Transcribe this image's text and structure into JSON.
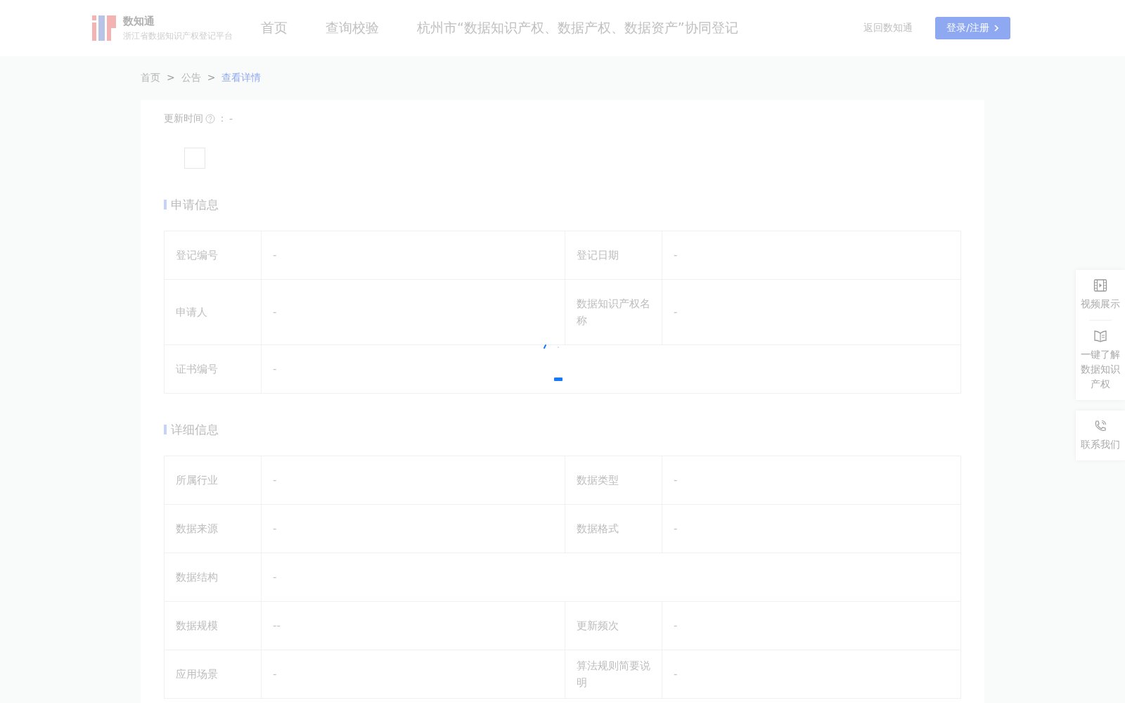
{
  "header": {
    "brand": "数知通",
    "subtitle": "浙江省数据知识产权登记平台",
    "nav": [
      {
        "label": "首页",
        "selected": false
      },
      {
        "label": "查询校验",
        "selected": false
      },
      {
        "label": "杭州市“数据知识产权、数据产权、数据资产”协同登记",
        "selected": false
      }
    ],
    "back_link": "返回数知通",
    "login_button": "登录/注册"
  },
  "breadcrumb": [
    {
      "label": "首页",
      "selected": false
    },
    {
      "label": "公告",
      "selected": false
    },
    {
      "label": "查看详情",
      "selected": true
    }
  ],
  "breadcrumb_separator": ">",
  "update_time": {
    "label": "更新时间",
    "colon": "：",
    "value": "-"
  },
  "sections": [
    {
      "title": "申请信息",
      "rows": [
        [
          {
            "label": "登记编号",
            "value": "-"
          },
          {
            "label": "登记日期",
            "value": "-"
          }
        ],
        [
          {
            "label": "申请人",
            "value": "-"
          },
          {
            "label": "数据知识产权名称",
            "value": "-"
          }
        ],
        [
          {
            "label": "证书编号",
            "value": "-"
          }
        ]
      ]
    },
    {
      "title": "详细信息",
      "rows": [
        [
          {
            "label": "所属行业",
            "value": "-"
          },
          {
            "label": "数据类型",
            "value": "-"
          }
        ],
        [
          {
            "label": "数据来源",
            "value": "-"
          },
          {
            "label": "数据格式",
            "value": "-"
          }
        ],
        [
          {
            "label": "数据结构",
            "value": "-"
          }
        ],
        [
          {
            "label": "数据规模",
            "value": "--"
          },
          {
            "label": "更新频次",
            "value": "-"
          }
        ],
        [
          {
            "label": "应用场景",
            "value": "-"
          },
          {
            "label": "算法规则简要说明",
            "value": "-"
          }
        ]
      ]
    }
  ],
  "float_panel": [
    {
      "kind": "video",
      "label": "视频展示"
    },
    {
      "kind": "book",
      "label": "一键了解数据知识产权"
    },
    {
      "kind": "phone",
      "label": "联系我们"
    }
  ]
}
